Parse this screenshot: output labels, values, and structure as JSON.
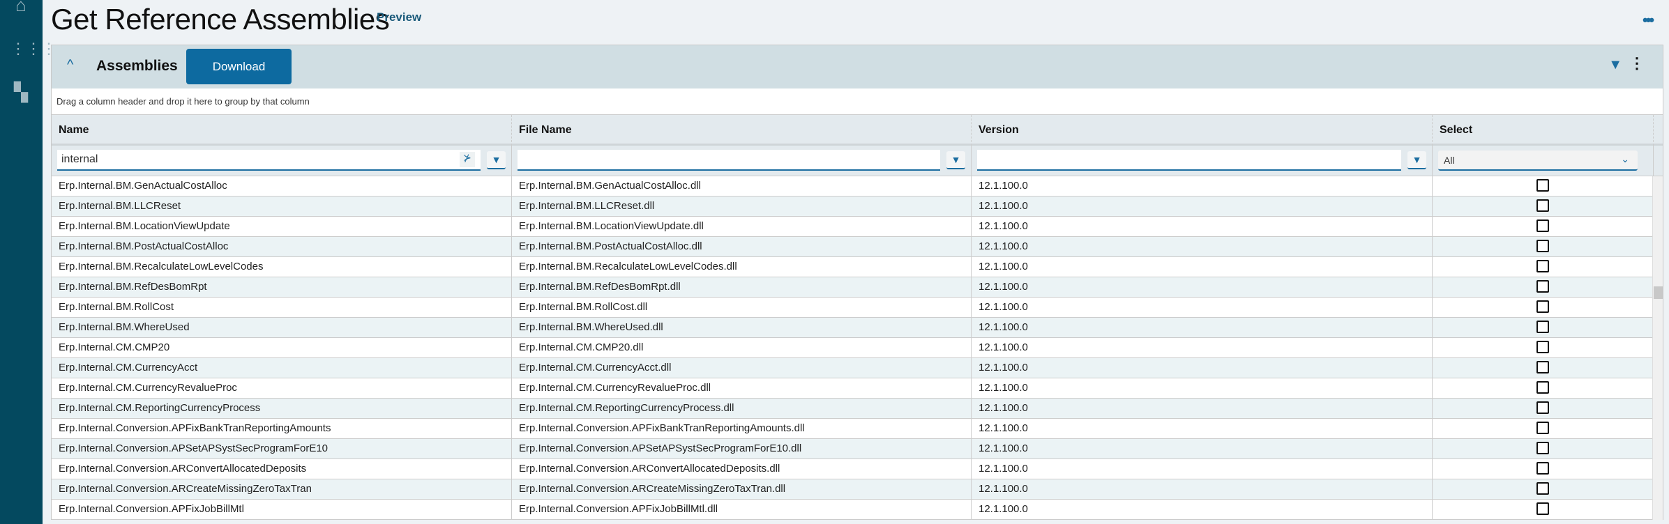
{
  "page": {
    "title": "Get Reference Assemblies",
    "badge": "Preview"
  },
  "panel": {
    "title": "Assemblies",
    "download_label": "Download",
    "group_hint": "Drag a column header and drop it here to group by that column"
  },
  "columns": [
    "Name",
    "File Name",
    "Version",
    "Select"
  ],
  "filters": {
    "name": "internal",
    "file_name": "",
    "version": "",
    "select": "All"
  },
  "rows": [
    {
      "name": "Erp.Internal.BM.GenActualCostAlloc",
      "file": "Erp.Internal.BM.GenActualCostAlloc.dll",
      "version": "12.1.100.0"
    },
    {
      "name": "Erp.Internal.BM.LLCReset",
      "file": "Erp.Internal.BM.LLCReset.dll",
      "version": "12.1.100.0"
    },
    {
      "name": "Erp.Internal.BM.LocationViewUpdate",
      "file": "Erp.Internal.BM.LocationViewUpdate.dll",
      "version": "12.1.100.0"
    },
    {
      "name": "Erp.Internal.BM.PostActualCostAlloc",
      "file": "Erp.Internal.BM.PostActualCostAlloc.dll",
      "version": "12.1.100.0"
    },
    {
      "name": "Erp.Internal.BM.RecalculateLowLevelCodes",
      "file": "Erp.Internal.BM.RecalculateLowLevelCodes.dll",
      "version": "12.1.100.0"
    },
    {
      "name": "Erp.Internal.BM.RefDesBomRpt",
      "file": "Erp.Internal.BM.RefDesBomRpt.dll",
      "version": "12.1.100.0"
    },
    {
      "name": "Erp.Internal.BM.RollCost",
      "file": "Erp.Internal.BM.RollCost.dll",
      "version": "12.1.100.0"
    },
    {
      "name": "Erp.Internal.BM.WhereUsed",
      "file": "Erp.Internal.BM.WhereUsed.dll",
      "version": "12.1.100.0"
    },
    {
      "name": "Erp.Internal.CM.CMP20",
      "file": "Erp.Internal.CM.CMP20.dll",
      "version": "12.1.100.0"
    },
    {
      "name": "Erp.Internal.CM.CurrencyAcct",
      "file": "Erp.Internal.CM.CurrencyAcct.dll",
      "version": "12.1.100.0"
    },
    {
      "name": "Erp.Internal.CM.CurrencyRevalueProc",
      "file": "Erp.Internal.CM.CurrencyRevalueProc.dll",
      "version": "12.1.100.0"
    },
    {
      "name": "Erp.Internal.CM.ReportingCurrencyProcess",
      "file": "Erp.Internal.CM.ReportingCurrencyProcess.dll",
      "version": "12.1.100.0"
    },
    {
      "name": "Erp.Internal.Conversion.APFixBankTranReportingAmounts",
      "file": "Erp.Internal.Conversion.APFixBankTranReportingAmounts.dll",
      "version": "12.1.100.0"
    },
    {
      "name": "Erp.Internal.Conversion.APSetAPSystSecProgramForE10",
      "file": "Erp.Internal.Conversion.APSetAPSystSecProgramForE10.dll",
      "version": "12.1.100.0"
    },
    {
      "name": "Erp.Internal.Conversion.ARConvertAllocatedDeposits",
      "file": "Erp.Internal.Conversion.ARConvertAllocatedDeposits.dll",
      "version": "12.1.100.0"
    },
    {
      "name": "Erp.Internal.Conversion.ARCreateMissingZeroTaxTran",
      "file": "Erp.Internal.Conversion.ARCreateMissingZeroTaxTran.dll",
      "version": "12.1.100.0"
    },
    {
      "name": "Erp.Internal.Conversion.APFixJobBillMtl",
      "file": "Erp.Internal.Conversion.APFixJobBillMtl.dll",
      "version": "12.1.100.0"
    }
  ]
}
